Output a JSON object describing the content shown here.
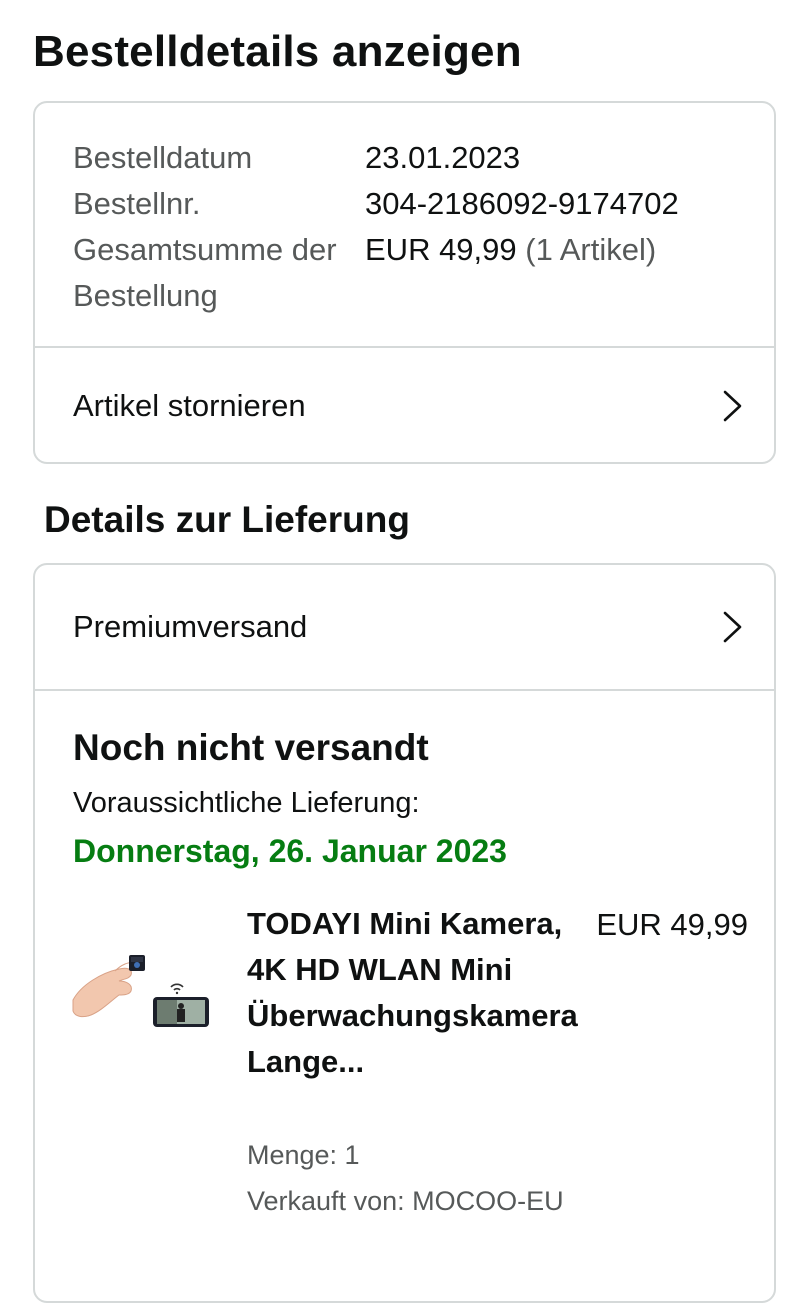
{
  "page": {
    "title": "Bestelldetails anzeigen"
  },
  "summary": {
    "rows": [
      {
        "label": "Bestelldatum",
        "value": "23.01.2023"
      },
      {
        "label": "Bestellnr.",
        "value": "304-2186092-9174702"
      },
      {
        "label": "Gesamtsumme der Bestellung",
        "value": "EUR 49,99",
        "extra": "(1 Artikel)"
      }
    ],
    "cancel_label": "Artikel stornieren"
  },
  "delivery": {
    "section_title": "Details zur Lieferung",
    "shipping_method": "Premiumversand",
    "status": "Noch nicht versandt",
    "eta_label": "Voraussichtliche Lieferung:",
    "eta_date": "Donnerstag, 26. Januar 2023",
    "eta_color": "#067d12",
    "item": {
      "title": "TODAYI Mini Kamera, 4K HD WLAN Mini Überwachungskamera Lange...",
      "price": "EUR 49,99",
      "quantity": "Menge: 1",
      "seller": "Verkauft von: MOCOO-EU",
      "image_icon": "mini-camera-product-image"
    }
  },
  "icons": {
    "chevron": "chevron-right-icon"
  },
  "colors": {
    "text": "#0f1111",
    "muted": "#565959",
    "border": "#d5d9d9",
    "success": "#067d12"
  }
}
